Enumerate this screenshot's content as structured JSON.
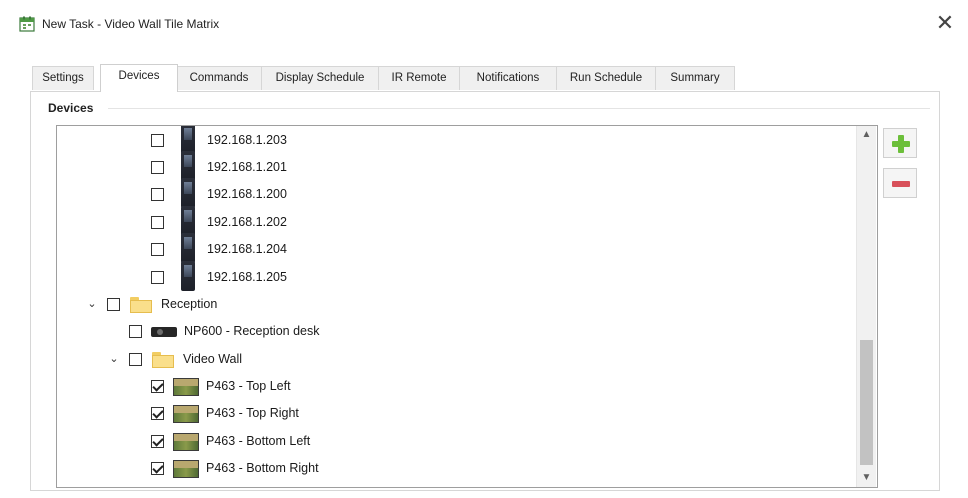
{
  "window": {
    "title": "New Task - Video Wall Tile Matrix",
    "close_glyph": "✕"
  },
  "tabs": [
    {
      "label": "Settings",
      "active": false
    },
    {
      "label": "Devices",
      "active": true
    },
    {
      "label": "Commands",
      "active": false
    },
    {
      "label": "Display Schedule",
      "active": false
    },
    {
      "label": "IR Remote",
      "active": false
    },
    {
      "label": "Notifications",
      "active": false
    },
    {
      "label": "Run Schedule",
      "active": false
    },
    {
      "label": "Summary",
      "active": false
    }
  ],
  "devices_group": {
    "title": "Devices",
    "tree": [
      {
        "label": "192.168.1.203",
        "checked": false,
        "icon": "handheld-device-icon"
      },
      {
        "label": "192.168.1.201",
        "checked": false,
        "icon": "handheld-device-icon"
      },
      {
        "label": "192.168.1.200",
        "checked": false,
        "icon": "handheld-device-icon"
      },
      {
        "label": "192.168.1.202",
        "checked": false,
        "icon": "handheld-device-icon"
      },
      {
        "label": "192.168.1.204",
        "checked": false,
        "icon": "handheld-device-icon"
      },
      {
        "label": "192.168.1.205",
        "checked": false,
        "icon": "handheld-device-icon"
      },
      {
        "label": "Reception",
        "checked": false,
        "icon": "folder-icon",
        "expanded": true
      },
      {
        "label": "NP600 - Reception desk",
        "checked": false,
        "icon": "projector-icon"
      },
      {
        "label": "Video Wall",
        "checked": false,
        "icon": "folder-icon",
        "expanded": true
      },
      {
        "label": "P463 - Top Left",
        "checked": true,
        "icon": "display-icon"
      },
      {
        "label": "P463 - Top Right",
        "checked": true,
        "icon": "display-icon"
      },
      {
        "label": "P463 - Bottom Left",
        "checked": true,
        "icon": "display-icon"
      },
      {
        "label": "P463 - Bottom Right",
        "checked": true,
        "icon": "display-icon"
      }
    ],
    "expander_glyph": "⌄",
    "scroll_up_glyph": "▲",
    "scroll_down_glyph": "▼"
  },
  "colors": {
    "add_green": "#6cbf3a",
    "remove_red": "#d8505a",
    "folder_yellow": "#fadf8b"
  }
}
